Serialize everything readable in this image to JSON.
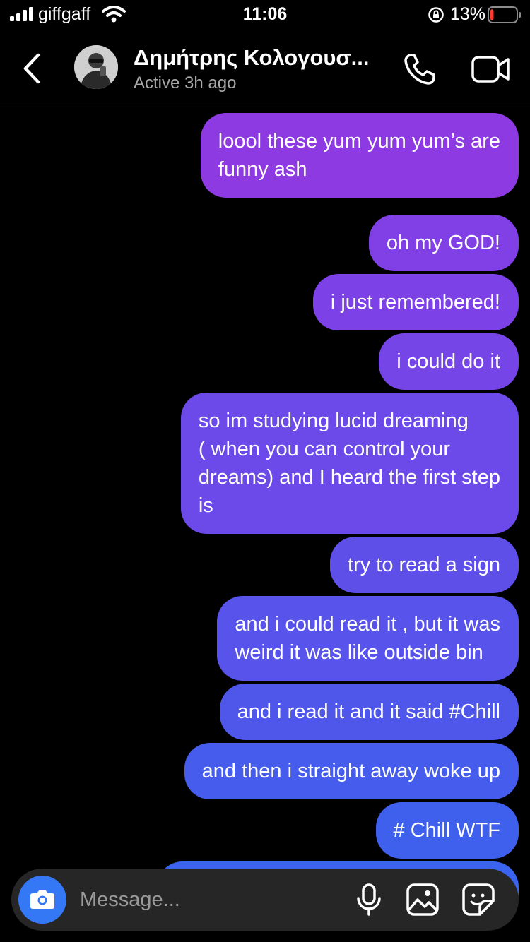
{
  "status_bar": {
    "carrier": "giffgaff",
    "time": "11:06",
    "battery_percent": "13%",
    "battery_level": 0.13
  },
  "header": {
    "contact_name": "Δημήτρης Κολογουσ...",
    "status": "Active 3h ago"
  },
  "messages": [
    {
      "text": "loool these yum yum yum’s are\nfunny ash",
      "color": "#8e3ae2"
    },
    {
      "text": "oh my GOD!",
      "color": "#813fe6"
    },
    {
      "text": "i just remembered!",
      "color": "#7c42e7"
    },
    {
      "text": "i could do it",
      "color": "#7545e8"
    },
    {
      "text": "so im studying lucid dreaming\n( when you can control your\ndreams) and I heard the first step\nis",
      "color": "#6b4ae9"
    },
    {
      "text": "try to read a sign",
      "color": "#5f4fe9"
    },
    {
      "text": "and i could read it , but it was\nweird it was like outside bin",
      "color": "#5853ea"
    },
    {
      "text": "and i read it and it said #Chill",
      "color": "#4f57eb"
    },
    {
      "text": "and then i straight away woke up",
      "color": "#465cec"
    },
    {
      "text": "# Chill WTF",
      "color": "#3f60ed"
    }
  ],
  "composer": {
    "placeholder": "Message..."
  },
  "colors": {
    "background": "#000000",
    "camera_button": "#3478f6",
    "composer_bg": "#262626"
  },
  "icons": [
    "signal-icon",
    "wifi-icon",
    "rotation-lock-icon",
    "battery-icon",
    "back-arrow-icon",
    "phone-icon",
    "video-camera-icon",
    "camera-icon",
    "microphone-icon",
    "image-icon",
    "sticker-icon"
  ]
}
